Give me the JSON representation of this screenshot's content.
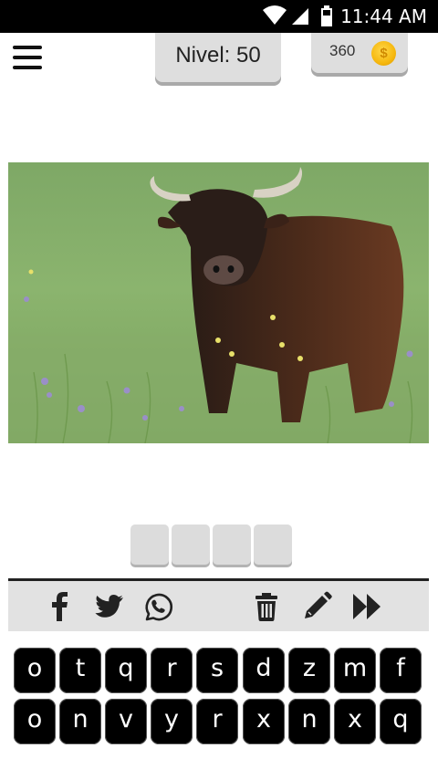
{
  "status_bar": {
    "time": "11:44 AM",
    "icons": [
      "wifi-icon",
      "signal-icon",
      "battery-icon"
    ]
  },
  "header": {
    "menu_icon": "hamburger-menu-icon",
    "level_text": "Nivel: 50",
    "coins": "360",
    "coin_icon": "gold-coin-icon",
    "coin_glyph": "$"
  },
  "puzzle": {
    "image_subject": "bull-photo",
    "answer_slots": [
      "",
      "",
      "",
      ""
    ]
  },
  "toolbar": {
    "items": [
      {
        "name": "facebook-share-button",
        "icon": "facebook-icon"
      },
      {
        "name": "twitter-share-button",
        "icon": "twitter-icon"
      },
      {
        "name": "whatsapp-share-button",
        "icon": "whatsapp-icon"
      },
      {
        "name": "delete-button",
        "icon": "trash-icon"
      },
      {
        "name": "hint-button",
        "icon": "pencil-icon"
      },
      {
        "name": "skip-button",
        "icon": "fast-forward-icon"
      }
    ]
  },
  "keyboard": {
    "row1": [
      "o",
      "t",
      "q",
      "r",
      "s",
      "d",
      "z",
      "m",
      "f"
    ],
    "row2": [
      "o",
      "n",
      "v",
      "y",
      "r",
      "x",
      "n",
      "x",
      "q"
    ]
  },
  "colors": {
    "status_bar": "#000000",
    "pill": "#dedede",
    "toolbar": "#e2e2e2",
    "key": "#000000",
    "coin": "#f6b80f"
  }
}
